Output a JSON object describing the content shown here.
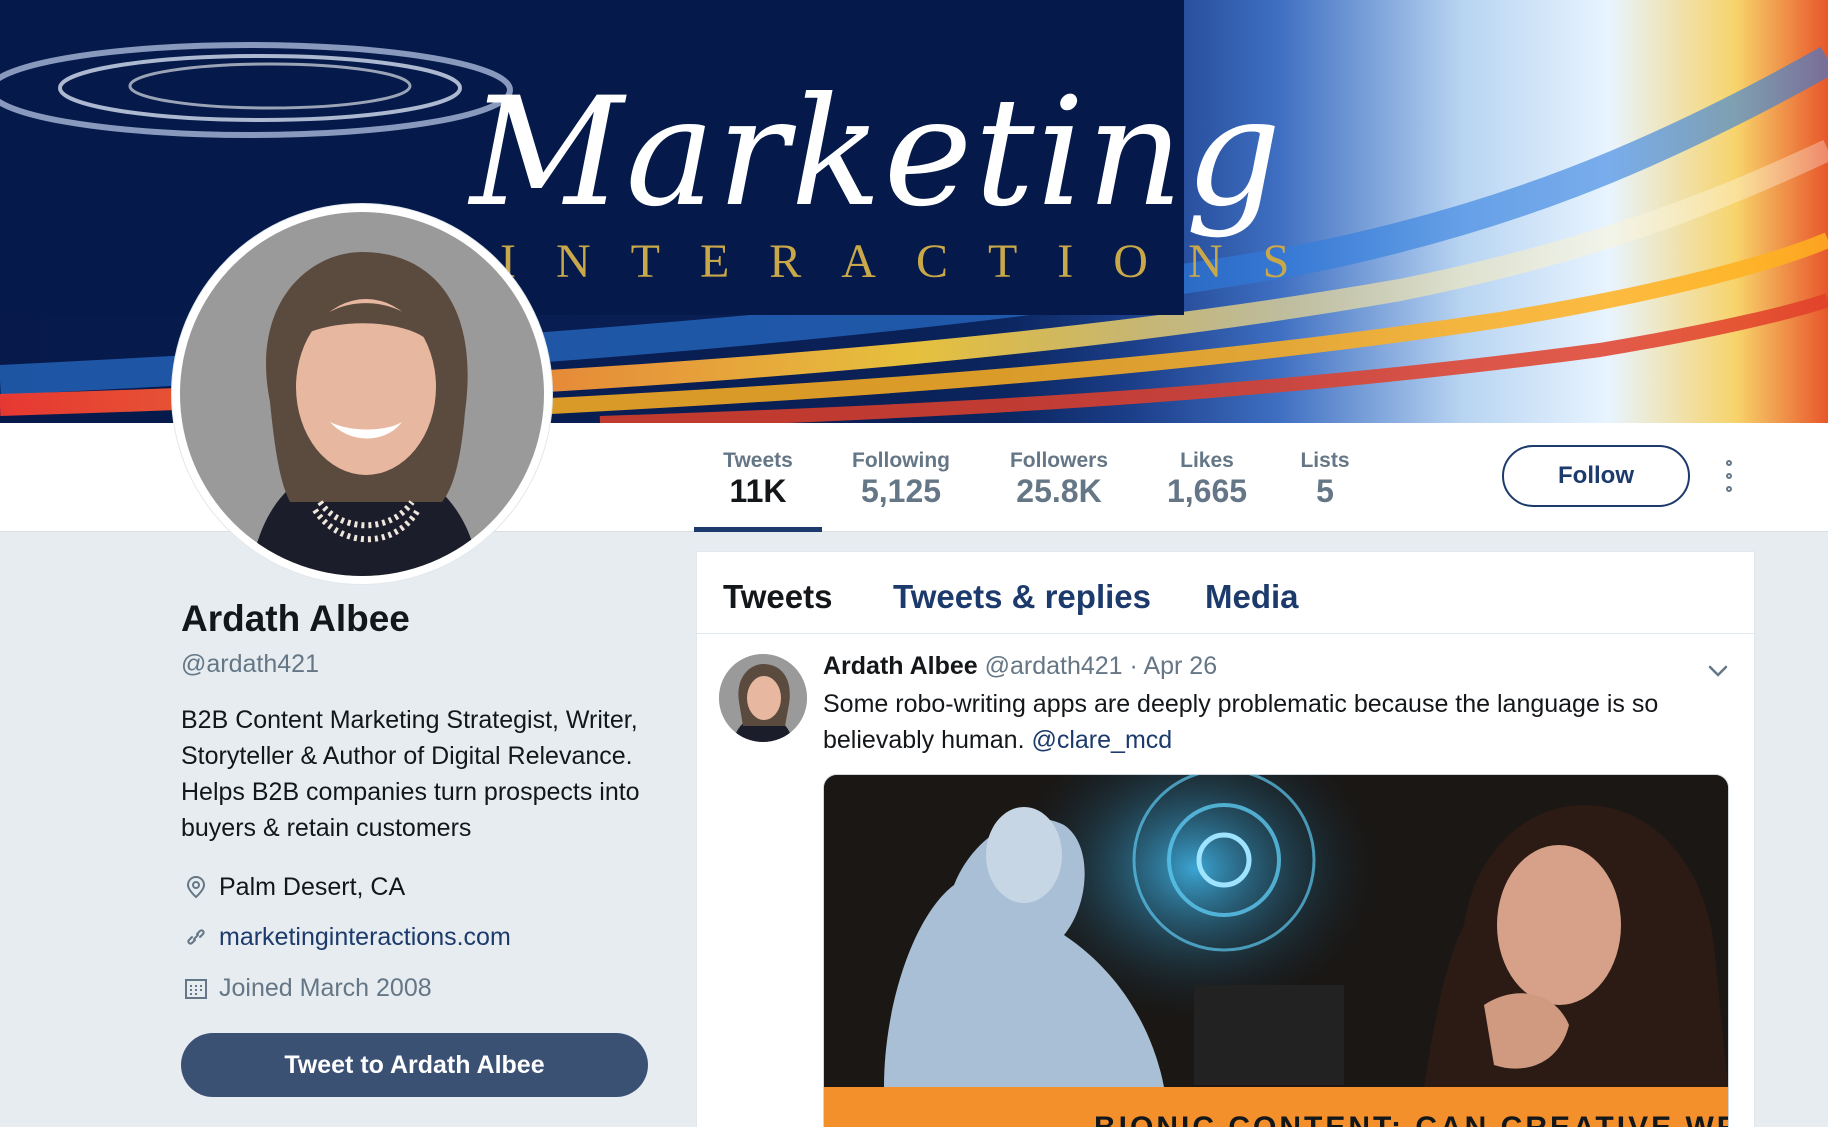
{
  "banner": {
    "title": "Marketing",
    "subtitle": "INTERACTIONS"
  },
  "stats": [
    {
      "label": "Tweets",
      "value": "11K"
    },
    {
      "label": "Following",
      "value": "5,125"
    },
    {
      "label": "Followers",
      "value": "25.8K"
    },
    {
      "label": "Likes",
      "value": "1,665"
    },
    {
      "label": "Lists",
      "value": "5"
    }
  ],
  "actions": {
    "follow_label": "Follow"
  },
  "profile": {
    "name": "Ardath Albee",
    "handle": "@ardath421",
    "bio": "B2B Content Marketing Strategist, Writer, Storyteller & Author of Digital Relevance. Helps B2B companies turn prospects into buyers & retain customers",
    "location": "Palm Desert, CA",
    "website": "marketinginteractions.com",
    "joined": "Joined March 2008",
    "tweet_to_label": "Tweet to Ardath Albee"
  },
  "timeline": {
    "tabs": [
      "Tweets",
      "Tweets & replies",
      "Media"
    ],
    "tweet": {
      "author": "Ardath Albee",
      "handle": "@ardath421",
      "date": "· Apr 26",
      "text": "Some robo-writing apps are deeply problematic because the language is so believably human.",
      "mention": "@clare_mcd",
      "media_caption": "BIONIC CONTENT: CAN CREATIVE WRITERS"
    }
  },
  "colors": {
    "accent": "#1c3a6b",
    "muted": "#657786",
    "background": "#e6ecf0",
    "button_dark": "#3b5174"
  },
  "icons": [
    "location-icon",
    "link-icon",
    "calendar-icon",
    "more-vertical-icon",
    "chevron-down-icon"
  ]
}
